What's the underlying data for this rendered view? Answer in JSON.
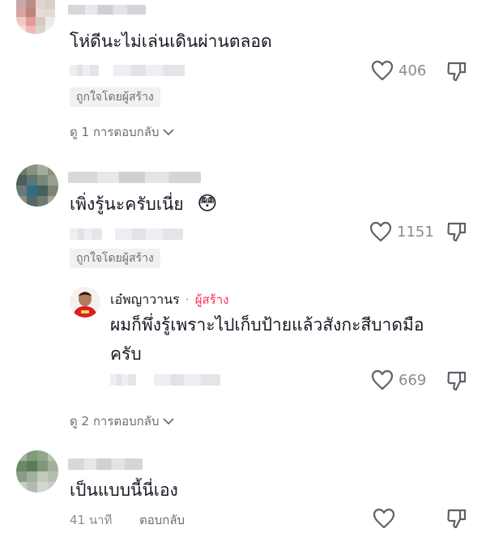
{
  "comments": [
    {
      "text": "โห่ดีนะไม่เล่นเดินผ่านตลอด",
      "likes": "406",
      "liked_badge": "ถูกใจโดยผู้สร้าง",
      "view_replies": "ดู 1 การตอบกลับ"
    },
    {
      "text": "เพิ่งรู้นะครับเนี่ย",
      "emoji": "😳",
      "likes": "1151",
      "liked_badge": "ถูกใจโดยผู้สร้าง",
      "reply": {
        "author": "เอ๋พญาวานร",
        "separator": "·",
        "creator_label": "ผู้สร้าง",
        "text_line1": "ผมก็พึ่งรู้เพราะไปเก็บป้ายแล้วสังกะสีบาดมือ",
        "text_line2": "ครับ",
        "likes": "669"
      },
      "view_replies": "ดู 2 การตอบกลับ"
    },
    {
      "text": "เป็นแบบนี้นี่เอง",
      "time": "41 นาที",
      "reply_label": "ตอบกลับ"
    }
  ],
  "colors": {
    "creator_accent": "#fe2c55",
    "text": "#161823",
    "muted": "#8a8b91"
  },
  "icons": [
    "heart-outline-icon",
    "dislike-icon",
    "chevron-down-icon"
  ]
}
